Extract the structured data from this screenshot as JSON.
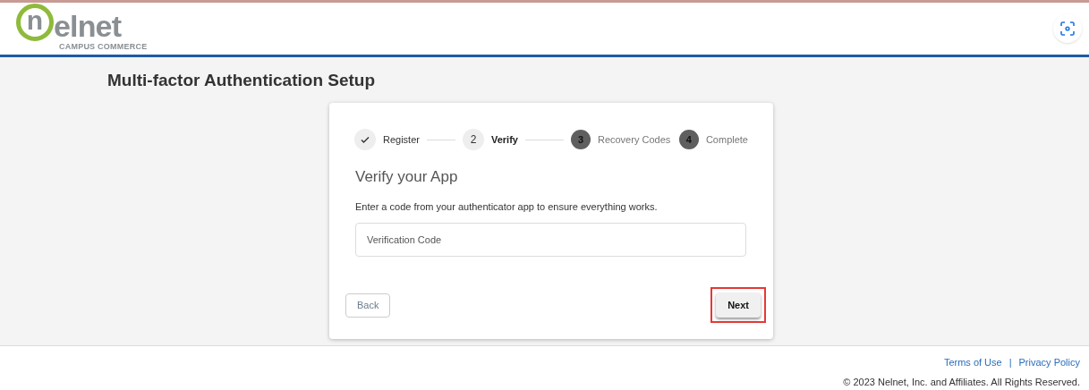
{
  "logo": {
    "initial": "n",
    "rest": "elnet",
    "tagline": "CAMPUS COMMERCE"
  },
  "page_title": "Multi-factor Authentication Setup",
  "steps": [
    {
      "label": "Register",
      "kind": "done"
    },
    {
      "number": "2",
      "label": "Verify",
      "kind": "current"
    },
    {
      "number": "3",
      "label": "Recovery Codes",
      "kind": "upcoming"
    },
    {
      "number": "4",
      "label": "Complete",
      "kind": "upcoming"
    }
  ],
  "heading": "Verify your App",
  "instructions": "Enter a code from your authenticator app to ensure everything works.",
  "code_field": {
    "placeholder": "Verification Code"
  },
  "back_button": "Back",
  "next_button": {
    "label": "Next",
    "highlighted": true
  },
  "footer": {
    "links": [
      "Terms of Use",
      "Privacy Policy"
    ],
    "separator": "|",
    "copyright": "© 2023 Nelnet, Inc. and Affiliates. All Rights Reserved."
  }
}
